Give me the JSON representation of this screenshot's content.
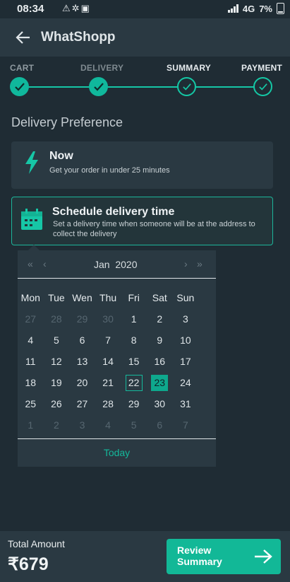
{
  "status_bar": {
    "time": "08:34",
    "network": "4G",
    "battery": "7%",
    "left_icons": [
      "warning-icon",
      "bluetooth-off-icon",
      "android-icon"
    ]
  },
  "app_bar": {
    "title": "WhatShopp"
  },
  "stepper": {
    "steps": [
      {
        "label": "CART",
        "state": "done"
      },
      {
        "label": "DELIVERY",
        "state": "done"
      },
      {
        "label": "SUMMARY",
        "state": "current"
      },
      {
        "label": "PAYMENT",
        "state": "pending"
      }
    ]
  },
  "section": {
    "title": "Delivery Preference"
  },
  "options": {
    "now": {
      "title": "Now",
      "desc": "Get your order in under 25 minutes"
    },
    "schedule": {
      "title": "Schedule delivery time",
      "desc": "Set a delivery time when someone will be at the address to collect the delivery"
    }
  },
  "calendar": {
    "month": "Jan",
    "year": "2020",
    "weekdays": [
      "Mon",
      "Tue",
      "Wen",
      "Thu",
      "Fri",
      "Sat",
      "Sun"
    ],
    "rows": [
      [
        "27",
        "28",
        "29",
        "30",
        "1",
        "2",
        "3"
      ],
      [
        "4",
        "5",
        "6",
        "7",
        "8",
        "9",
        "10"
      ],
      [
        "11",
        "12",
        "13",
        "14",
        "15",
        "16",
        "17"
      ],
      [
        "18",
        "19",
        "20",
        "21",
        "22",
        "23",
        "24"
      ],
      [
        "25",
        "26",
        "27",
        "28",
        "29",
        "30",
        "31"
      ],
      [
        "1",
        "2",
        "3",
        "4",
        "5",
        "6",
        "7"
      ]
    ],
    "today": "22",
    "selected": "23",
    "today_label": "Today"
  },
  "bottom_bar": {
    "total_label": "Total Amount",
    "total_value": "₹679",
    "button_label": "Review Summary"
  },
  "colors": {
    "accent": "#12b897",
    "background": "#1f2c34",
    "surface": "#2a3942"
  }
}
